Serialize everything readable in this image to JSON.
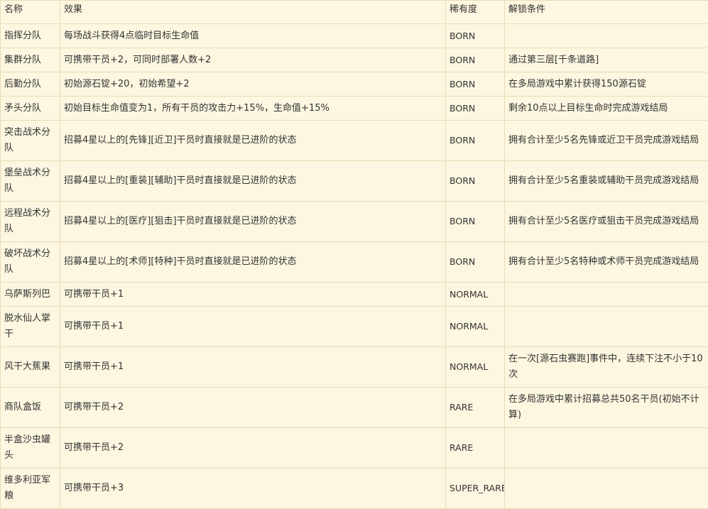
{
  "headers": {
    "name": "名称",
    "effect": "效果",
    "rarity": "稀有度",
    "unlock": "解锁条件"
  },
  "rows": [
    {
      "name": "指挥分队",
      "effect": "每场战斗获得4点临时目标生命值",
      "rarity": "BORN",
      "unlock": ""
    },
    {
      "name": "集群分队",
      "effect": "可携带干员+2，可同时部署人数+2",
      "rarity": "BORN",
      "unlock": "通过第三层[千条道路]"
    },
    {
      "name": "后勤分队",
      "effect": "初始源石锭+20，初始希望+2",
      "rarity": "BORN",
      "unlock": "在多局游戏中累计获得150源石锭"
    },
    {
      "name": "矛头分队",
      "effect": "初始目标生命值变为1，所有干员的攻击力+15%，生命值+15%",
      "rarity": "BORN",
      "unlock": "剩余10点以上目标生命时完成游戏结局"
    },
    {
      "name": "突击战术分队",
      "effect": "招募4星以上的[先锋][近卫]干员时直接就是已进阶的状态",
      "rarity": "BORN",
      "unlock": "拥有合计至少5名先锋或近卫干员完成游戏结局"
    },
    {
      "name": "堡垒战术分队",
      "effect": "招募4星以上的[重装][辅助]干员时直接就是已进阶的状态",
      "rarity": "BORN",
      "unlock": "拥有合计至少5名重装或辅助干员完成游戏结局"
    },
    {
      "name": "远程战术分队",
      "effect": "招募4星以上的[医疗][狙击]干员时直接就是已进阶的状态",
      "rarity": "BORN",
      "unlock": "拥有合计至少5名医疗或狙击干员完成游戏结局"
    },
    {
      "name": "破坏战术分队",
      "effect": "招募4星以上的[术师][特种]干员时直接就是已进阶的状态",
      "rarity": "BORN",
      "unlock": "拥有合计至少5名特种或术师干员完成游戏结局"
    },
    {
      "name": "乌萨斯列巴",
      "effect": "可携带干员+1",
      "rarity": "NORMAL",
      "unlock": ""
    },
    {
      "name": "脱水仙人掌干",
      "effect": "可携带干员+1",
      "rarity": "NORMAL",
      "unlock": ""
    },
    {
      "name": "风干大蕉果",
      "effect": "可携带干员+1",
      "rarity": "NORMAL",
      "unlock": "在一次[源石虫赛跑]事件中，连续下注不小于10次"
    },
    {
      "name": "商队盒饭",
      "effect": "可携带干员+2",
      "rarity": "RARE",
      "unlock": "在多局游戏中累计招募总共50名干员(初始不计算)"
    },
    {
      "name": "半盒沙虫罐头",
      "effect": "可携带干员+2",
      "rarity": "RARE",
      "unlock": ""
    },
    {
      "name": "维多利亚军粮",
      "effect": "可携带干员+3",
      "rarity": "SUPER_RARE",
      "unlock": ""
    }
  ]
}
